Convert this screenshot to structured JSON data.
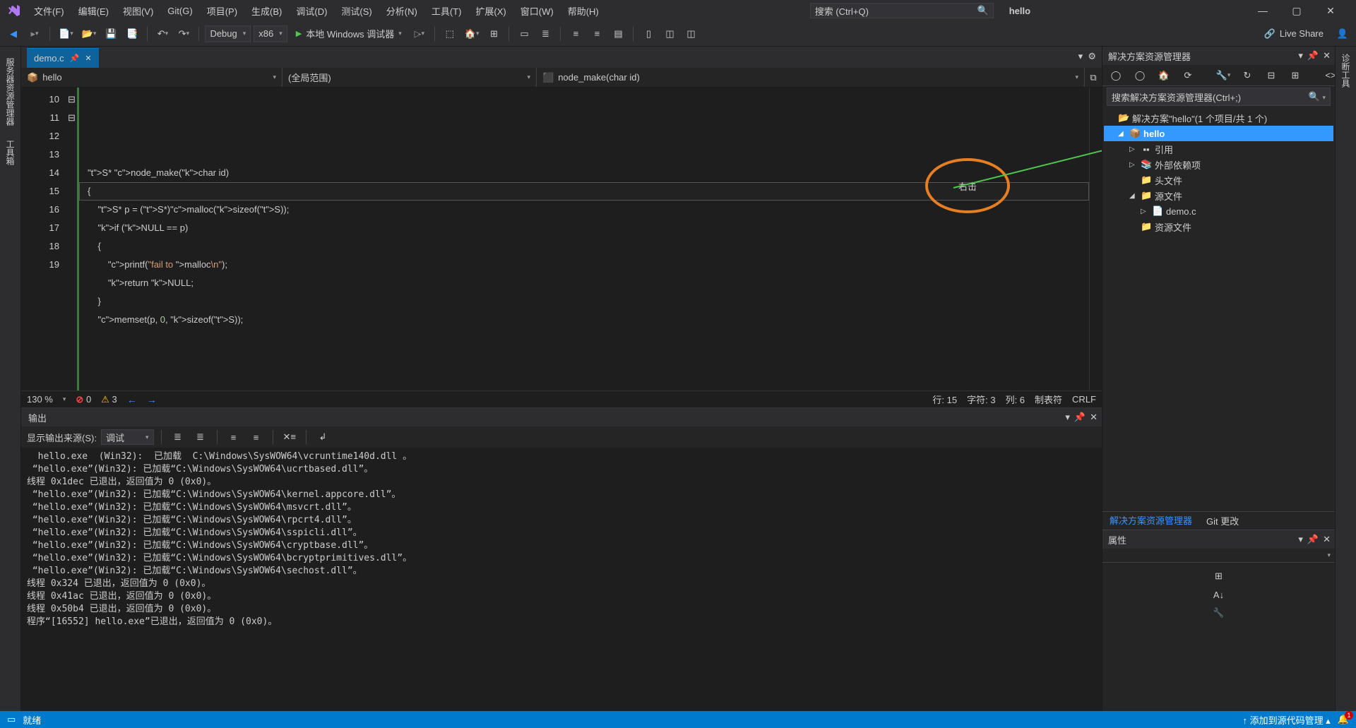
{
  "title": {
    "solution_name": "hello"
  },
  "menu": {
    "file": "文件(F)",
    "edit": "编辑(E)",
    "view": "视图(V)",
    "git": "Git(G)",
    "project": "项目(P)",
    "build": "生成(B)",
    "debug": "调试(D)",
    "test": "测试(S)",
    "analyze": "分析(N)",
    "tools": "工具(T)",
    "extensions": "扩展(X)",
    "window": "窗口(W)",
    "help": "帮助(H)"
  },
  "title_search": {
    "placeholder": "搜索 (Ctrl+Q)"
  },
  "toolbar": {
    "config": "Debug",
    "platform": "x86",
    "start_label": "本地 Windows 调试器",
    "live_share": "Live Share"
  },
  "file_tab": {
    "name": "demo.c"
  },
  "nav": {
    "scope1": "hello",
    "scope2": "(全局范围)",
    "scope3": "node_make(char id)"
  },
  "code": {
    "line_start": 10,
    "lines": [
      "",
      "S* node_make(char id)",
      "{",
      "    S* p = (S*)malloc(sizeof(S));",
      "    if (NULL == p)",
      "    {",
      "        printf(\"fail to malloc\\n\");",
      "        return NULL;",
      "    }",
      "    memset(p, 0, sizeof(S));"
    ]
  },
  "editor_status": {
    "zoom": "130 %",
    "errors": "0",
    "warnings": "3",
    "line": "行: 15",
    "char": "字符: 3",
    "col": "列: 6",
    "ins": "制表符",
    "crlf": "CRLF"
  },
  "annotation": {
    "text": "右击"
  },
  "output": {
    "title": "输出",
    "source_label": "显示输出来源(S):",
    "source_value": "调试",
    "text": "  hello.exe  (Win32):  已加载  C:\\Windows\\SysWOW64\\vcruntime140d.dll 。\n “hello.exe”(Win32): 已加载“C:\\Windows\\SysWOW64\\ucrtbased.dll”。\n线程 0x1dec 已退出，返回值为 0 (0x0)。\n “hello.exe”(Win32): 已加载“C:\\Windows\\SysWOW64\\kernel.appcore.dll”。\n “hello.exe”(Win32): 已加载“C:\\Windows\\SysWOW64\\msvcrt.dll”。\n “hello.exe”(Win32): 已加载“C:\\Windows\\SysWOW64\\rpcrt4.dll”。\n “hello.exe”(Win32): 已加载“C:\\Windows\\SysWOW64\\sspicli.dll”。\n “hello.exe”(Win32): 已加载“C:\\Windows\\SysWOW64\\cryptbase.dll”。\n “hello.exe”(Win32): 已加载“C:\\Windows\\SysWOW64\\bcryptprimitives.dll”。\n “hello.exe”(Win32): 已加载“C:\\Windows\\SysWOW64\\sechost.dll”。\n线程 0x324 已退出，返回值为 0 (0x0)。\n线程 0x41ac 已退出，返回值为 0 (0x0)。\n线程 0x50b4 已退出，返回值为 0 (0x0)。\n程序“[16552] hello.exe”已退出，返回值为 0 (0x0)。"
  },
  "solution_explorer": {
    "title": "解决方案资源管理器",
    "search_placeholder": "搜索解决方案资源管理器(Ctrl+;)",
    "root": "解决方案\"hello\"(1 个项目/共 1 个)",
    "project": "hello",
    "refs": "引用",
    "ext_deps": "外部依赖项",
    "headers": "头文件",
    "sources": "源文件",
    "demo": "demo.c",
    "resources": "资源文件",
    "tabs": {
      "explorer": "解决方案资源管理器",
      "git": "Git 更改"
    }
  },
  "properties": {
    "title": "属性"
  },
  "left_dock": {
    "server": "服务器资源管理器",
    "toolbox": "工具箱"
  },
  "right_dock": {
    "diag": "诊断工具"
  },
  "statusbar": {
    "ready": "就绪",
    "add_src": "添加到源代码管理",
    "notif_count": "1"
  }
}
